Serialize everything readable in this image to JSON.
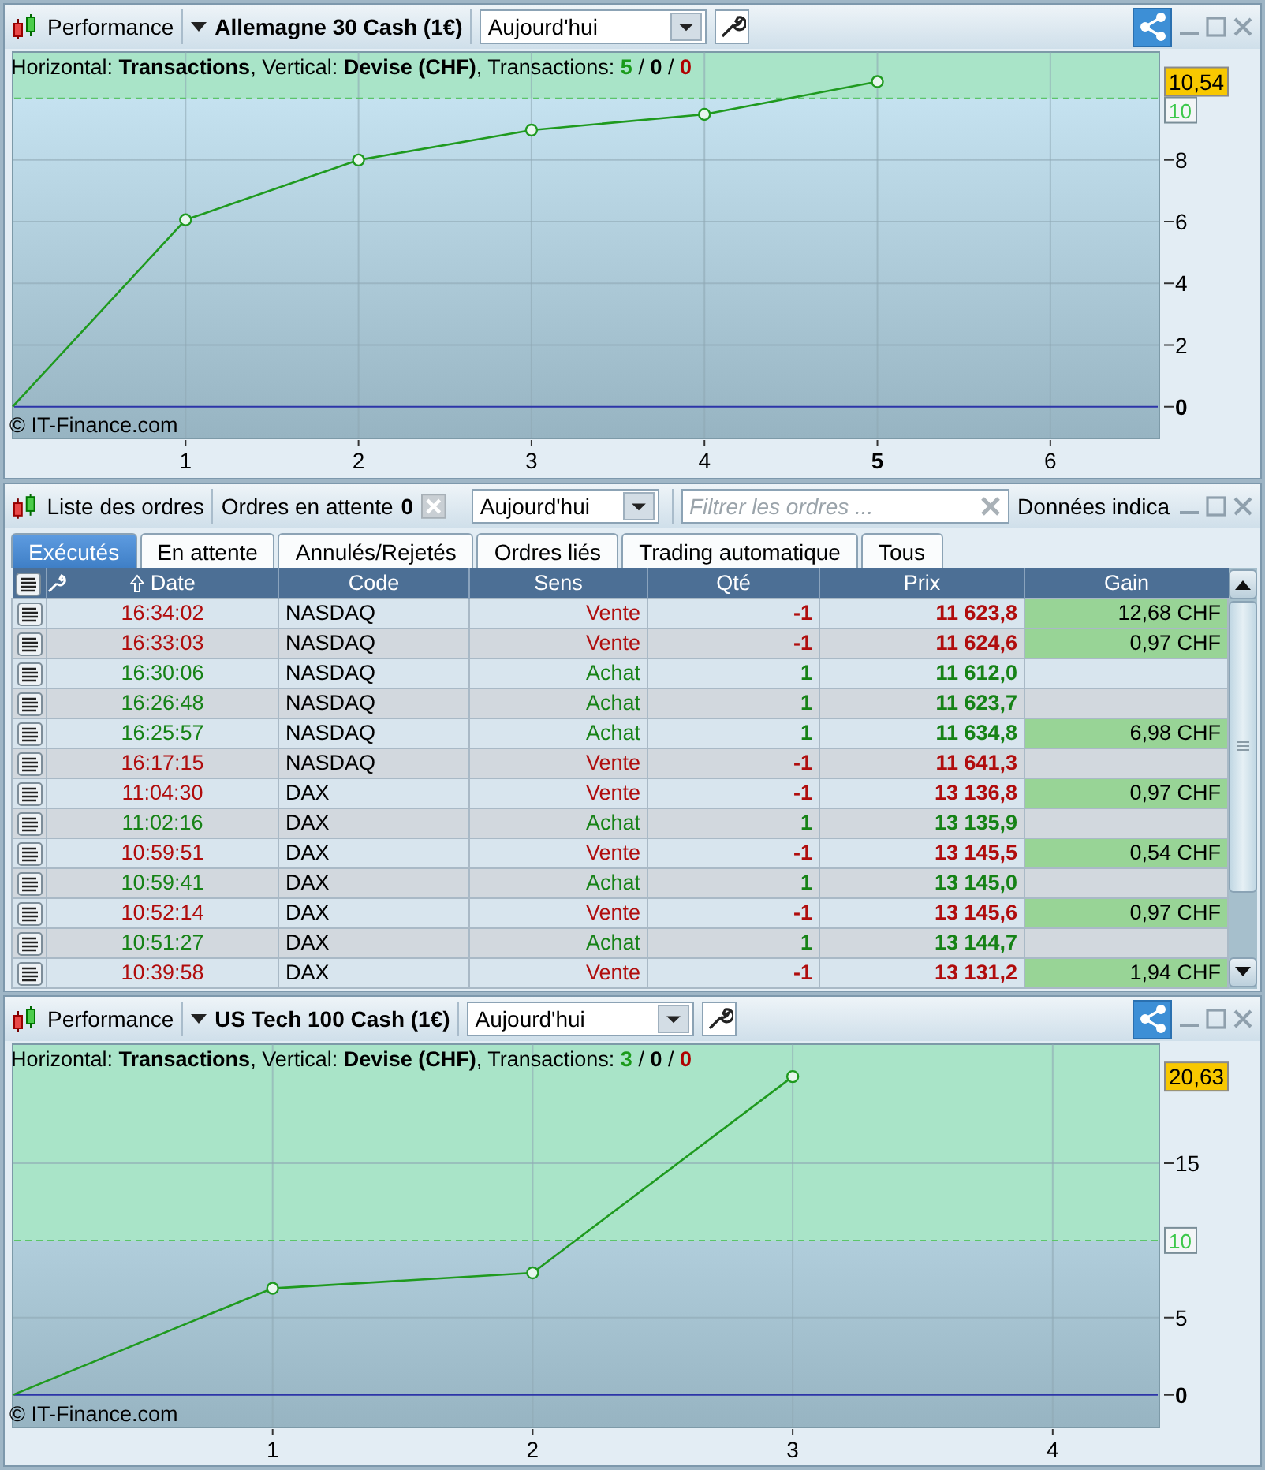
{
  "panels": [
    {
      "kind": "chart",
      "title": "Performance",
      "instrument": "Allemagne 30 Cash (1€)",
      "period": "Aujourd'hui",
      "legend": {
        "text": "Horizontal: **Transactions**, Vertical: **Devise (CHF)**, Transactions:",
        "separator": "/",
        "counts": [
          {
            "value": "5",
            "kind": "won"
          },
          {
            "value": "0",
            "kind": "neutral"
          },
          {
            "value": "0",
            "kind": "lost"
          }
        ]
      },
      "copyright": "© IT-Finance.com",
      "chart_data": {
        "type": "line",
        "x": [
          0,
          1,
          2,
          3,
          4,
          5
        ],
        "series": [
          {
            "color": "#1f9a1f",
            "marker": "o",
            "values": [
              0,
              6.06,
              8.0,
              8.97,
              9.48,
              10.54
            ]
          }
        ],
        "xlim": [
          0,
          6.63
        ],
        "ylim": [
          -1.03,
          11.5
        ],
        "xticks": [
          1,
          2,
          3,
          4,
          {
            "value": 5,
            "label": "5"
          },
          6
        ],
        "yticks": [
          0,
          2,
          4,
          6,
          8,
          {
            "value": 10,
            "label": "10"
          }
        ],
        "grid": true,
        "ref_lines": [
          {
            "axis": "y",
            "value": 10,
            "color": "#5cc46a"
          },
          {
            "axis": "y",
            "value": 0,
            "color": "#2c35a8"
          }
        ],
        "bands": [
          {
            "axis": "y",
            "from": 10,
            "to": 11.5,
            "color": "#a9e4c8"
          }
        ],
        "annotations": [
          "10,54"
        ]
      }
    },
    {
      "kind": "orders",
      "title": "Liste des ordres",
      "pending_label": "Ordres en attente",
      "pending_count": "0",
      "period": "Aujourd'hui",
      "filter": {
        "placeholder": "Filtrer les ordres ..."
      },
      "side_label": "Données indica",
      "tabs": [
        {
          "label": "Exécutés",
          "selected": true
        },
        {
          "label": "En attente",
          "selected": false
        },
        {
          "label": "Annulés/Rejetés",
          "selected": false
        },
        {
          "label": "Ordres liés",
          "selected": false
        },
        {
          "label": "Trading automatique",
          "selected": false
        },
        {
          "label": "Tous",
          "selected": false
        }
      ],
      "columns": [
        {
          "label": "Date",
          "sorted": true
        },
        {
          "label": "Code",
          "sorted": false
        },
        {
          "label": "Sens",
          "sorted": false
        },
        {
          "label": "Qté",
          "sorted": false
        },
        {
          "label": "Prix",
          "sorted": false
        },
        {
          "label": "Gain",
          "sorted": false
        }
      ],
      "rows": [
        {
          "kind": "sell",
          "date": "16:34:02",
          "code": "NASDAQ",
          "side": "Vente",
          "qty": "-1",
          "price": "11 623,8",
          "gain": "12,68 CHF"
        },
        {
          "kind": "sell",
          "date": "16:33:03",
          "code": "NASDAQ",
          "side": "Vente",
          "qty": "-1",
          "price": "11 624,6",
          "gain": "0,97 CHF"
        },
        {
          "kind": "buy",
          "date": "16:30:06",
          "code": "NASDAQ",
          "side": "Achat",
          "qty": "1",
          "price": "11 612,0"
        },
        {
          "kind": "buy",
          "date": "16:26:48",
          "code": "NASDAQ",
          "side": "Achat",
          "qty": "1",
          "price": "11 623,7"
        },
        {
          "kind": "buy",
          "date": "16:25:57",
          "code": "NASDAQ",
          "side": "Achat",
          "qty": "1",
          "price": "11 634,8",
          "gain": "6,98 CHF"
        },
        {
          "kind": "sell",
          "date": "16:17:15",
          "code": "NASDAQ",
          "side": "Vente",
          "qty": "-1",
          "price": "11 641,3"
        },
        {
          "kind": "sell",
          "date": "11:04:30",
          "code": "DAX",
          "side": "Vente",
          "qty": "-1",
          "price": "13 136,8",
          "gain": "0,97 CHF"
        },
        {
          "kind": "buy",
          "date": "11:02:16",
          "code": "DAX",
          "side": "Achat",
          "qty": "1",
          "price": "13 135,9"
        },
        {
          "kind": "sell",
          "date": "10:59:51",
          "code": "DAX",
          "side": "Vente",
          "qty": "-1",
          "price": "13 145,5",
          "gain": "0,54 CHF"
        },
        {
          "kind": "buy",
          "date": "10:59:41",
          "code": "DAX",
          "side": "Achat",
          "qty": "1",
          "price": "13 145,0"
        },
        {
          "kind": "sell",
          "date": "10:52:14",
          "code": "DAX",
          "side": "Vente",
          "qty": "-1",
          "price": "13 145,6",
          "gain": "0,97 CHF"
        },
        {
          "kind": "buy",
          "date": "10:51:27",
          "code": "DAX",
          "side": "Achat",
          "qty": "1",
          "price": "13 144,7"
        },
        {
          "kind": "sell",
          "date": "10:39:58",
          "code": "DAX",
          "side": "Vente",
          "qty": "-1",
          "price": "13 131,2",
          "gain": "1,94 CHF"
        }
      ]
    },
    {
      "kind": "chart",
      "title": "Performance",
      "instrument": "US Tech 100 Cash (1€)",
      "period": "Aujourd'hui",
      "legend": {
        "text": "Horizontal: **Transactions**, Vertical: **Devise (CHF)**, Transactions:",
        "separator": "/",
        "counts": [
          {
            "value": "3",
            "kind": "won"
          },
          {
            "value": "0",
            "kind": "neutral"
          },
          {
            "value": "0",
            "kind": "lost"
          }
        ]
      },
      "copyright": "© IT-Finance.com",
      "chart_data": {
        "type": "line",
        "x": [
          0,
          1,
          2,
          3
        ],
        "series": [
          {
            "color": "#1f9a1f",
            "marker": "o",
            "values": [
              0,
              6.9,
              7.9,
              20.6
            ]
          }
        ],
        "xlim": [
          0,
          4.41
        ],
        "ylim": [
          -2.1,
          22.7
        ],
        "xticks": [
          1,
          2,
          3,
          4
        ],
        "yticks": [
          0,
          5,
          {
            "value": 10,
            "label": "10"
          },
          15
        ],
        "grid": true,
        "ref_lines": [
          {
            "axis": "y",
            "value": 10,
            "color": "#5cc46a"
          },
          {
            "axis": "y",
            "value": 0,
            "color": "#2c35a8"
          }
        ],
        "bands": [
          {
            "axis": "y",
            "from": 10,
            "to": 22.7,
            "color": "#a9e4c8"
          }
        ],
        "annotations": [
          "20,63"
        ]
      }
    }
  ]
}
